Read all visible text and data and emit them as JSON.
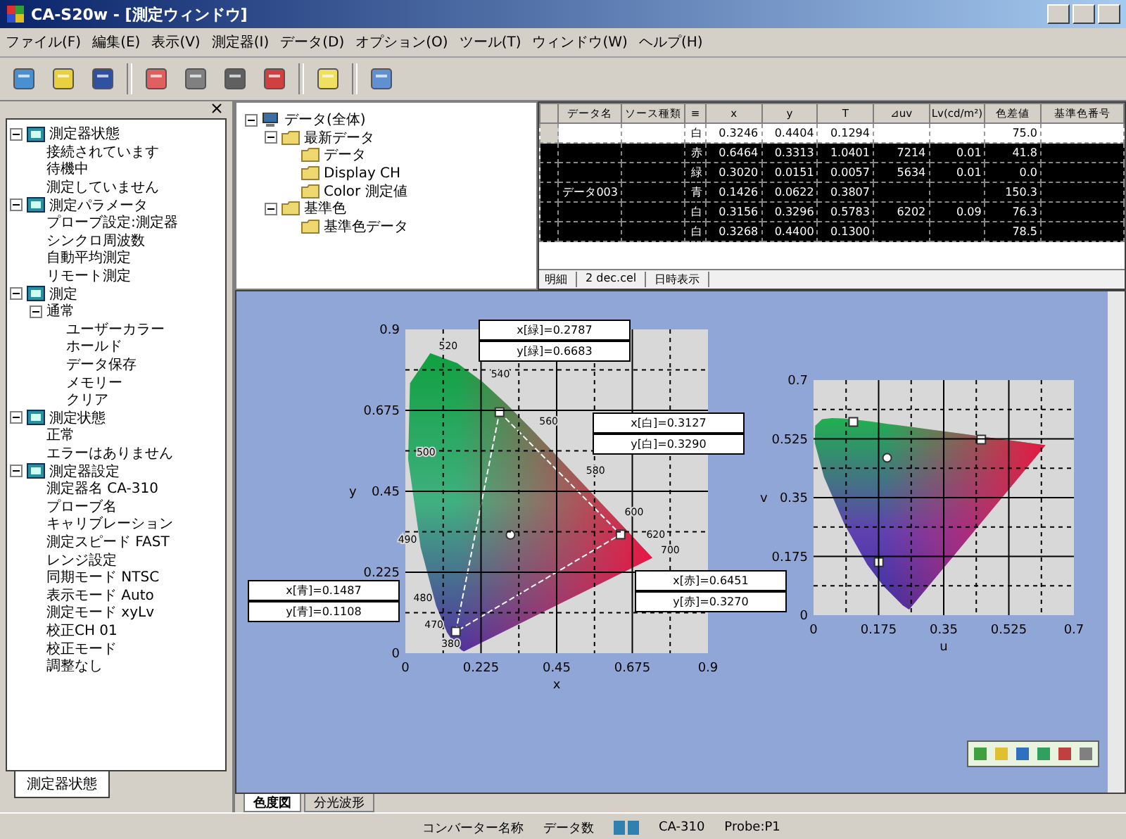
{
  "window": {
    "title": "CA-S20w - [測定ウィンドウ]"
  },
  "menu": [
    "ファイル(F)",
    "編集(E)",
    "表示(V)",
    "測定器(I)",
    "データ(D)",
    "オプション(O)",
    "ツール(T)",
    "ウィンドウ(W)",
    "ヘルプ(H)"
  ],
  "status_tree": [
    {
      "label": "測定器状態",
      "expanded": true,
      "children": [
        {
          "label": "接続されています"
        },
        {
          "label": "待機中"
        },
        {
          "label": "測定していません"
        }
      ]
    },
    {
      "label": "測定パラメータ",
      "expanded": true,
      "children": [
        {
          "label": "プローブ設定:測定器"
        },
        {
          "label": "シンクロ周波数"
        },
        {
          "label": "自動平均測定"
        },
        {
          "label": "リモート測定"
        }
      ]
    },
    {
      "label": "測定",
      "expanded": true,
      "children": [
        {
          "label": "通常",
          "expanded": true,
          "children": [
            {
              "label": "ユーザーカラー"
            },
            {
              "label": "ホールド"
            },
            {
              "label": "データ保存"
            },
            {
              "label": "メモリー"
            },
            {
              "label": "クリア"
            }
          ]
        }
      ]
    },
    {
      "label": "測定状態",
      "expanded": true,
      "children": [
        {
          "label": "正常"
        },
        {
          "label": "エラーはありません"
        }
      ]
    },
    {
      "label": "測定器設定",
      "expanded": true,
      "children": [
        {
          "label": "測定器名 CA-310"
        },
        {
          "label": "プローブ名"
        },
        {
          "label": "キャリブレーション"
        },
        {
          "label": "測定スピード FAST"
        },
        {
          "label": "レンジ設定"
        },
        {
          "label": "同期モード NTSC"
        },
        {
          "label": "表示モード Auto"
        },
        {
          "label": "測定モード xyLv"
        },
        {
          "label": "校正CH 01"
        },
        {
          "label": "校正モード"
        },
        {
          "label": "調整なし"
        }
      ]
    }
  ],
  "left_tab": {
    "label": "測定器状態"
  },
  "data_tree": [
    {
      "label": "データ(全体)",
      "expanded": true,
      "children": [
        {
          "label": "最新データ",
          "expanded": true,
          "children": [
            {
              "label": "データ"
            },
            {
              "label": "Display CH"
            },
            {
              "label": "Color 測定値"
            }
          ]
        },
        {
          "label": "基準色",
          "expanded": true,
          "children": [
            {
              "label": "基準色データ"
            }
          ]
        }
      ]
    }
  ],
  "grid": {
    "columns": [
      "データ名",
      "ソース種類",
      "≡",
      "x",
      "y",
      "T",
      "⊿uv",
      "Lv(cd/m²)",
      "色差値",
      "基準色番号"
    ],
    "rows": [
      {
        "selected": false,
        "cells": [
          "",
          "",
          "白",
          "0.3246",
          "0.4404",
          "0.1294",
          "",
          "",
          "75.0",
          "",
          ""
        ]
      },
      {
        "selected": true,
        "cells": [
          "",
          "",
          "赤",
          "0.6464",
          "0.3313",
          "1.0401",
          "7214",
          "0.01",
          "41.8",
          "",
          ""
        ]
      },
      {
        "selected": true,
        "cells": [
          "",
          "",
          "緑",
          "0.3020",
          "0.0151",
          "0.0057",
          "5634",
          "0.01",
          "0.0",
          "",
          ""
        ]
      },
      {
        "selected": true,
        "cells": [
          "データ003",
          "",
          "青",
          "0.1426",
          "0.0622",
          "0.3807",
          "",
          "",
          "150.3",
          "",
          ""
        ]
      },
      {
        "selected": true,
        "cells": [
          "",
          "",
          "白",
          "0.3156",
          "0.3296",
          "0.5783",
          "6202",
          "0.09",
          "76.3",
          "",
          ""
        ]
      },
      {
        "selected": true,
        "cells": [
          "",
          "",
          "白",
          "0.3268",
          "0.4400",
          "0.1300",
          "",
          "",
          "78.5",
          "",
          ""
        ]
      }
    ],
    "footer": [
      "明細",
      "2 dec.cel",
      "日時表示"
    ]
  },
  "xy_chart": {
    "xlabel": "x",
    "ylabel": "y",
    "xticks": [
      "0",
      "0.225",
      "0.45",
      "0.675",
      "0.9"
    ],
    "yticks": [
      "0.9",
      "0.675",
      "0.45",
      "0.225",
      "0"
    ],
    "wavelengths": [
      "520",
      "540",
      "500",
      "560",
      "580",
      "600",
      "620",
      "700",
      "490",
      "480",
      "470",
      "380"
    ]
  },
  "uv_chart": {
    "xlabel": "u",
    "ylabel": "v",
    "xticks": [
      "0",
      "0.175",
      "0.35",
      "0.525",
      "0.7"
    ],
    "yticks": [
      "0.7",
      "0.525",
      "0.35",
      "0.175",
      "0"
    ]
  },
  "readouts": [
    {
      "lines": [
        "x[緑]=0.2787",
        "y[緑]=0.6683"
      ]
    },
    {
      "lines": [
        "x[白]=0.3127",
        "y[白]=0.3290"
      ]
    },
    {
      "lines": [
        "x[青]=0.1487",
        "y[青]=0.1108"
      ]
    },
    {
      "lines": [
        "x[赤]=0.6451",
        "y[赤]=0.3270"
      ]
    }
  ],
  "sheet_tabs": [
    {
      "label": "色度図",
      "selected": true
    },
    {
      "label": "分光波形",
      "selected": false
    }
  ],
  "status_bar": [
    "コンバーター名称",
    "データ数",
    "CA-310",
    "Probe:P1"
  ]
}
